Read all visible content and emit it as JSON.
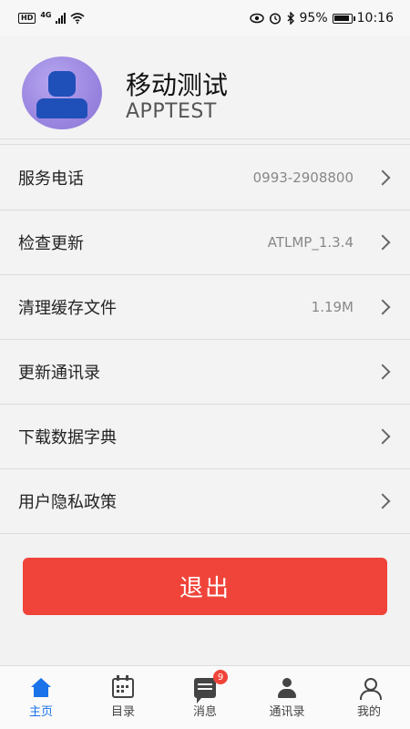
{
  "status_bar": {
    "hd": "HD",
    "network": "4G",
    "battery_percent": "95%",
    "time": "10:16",
    "icons": [
      "wifi-icon",
      "eye-icon",
      "alarm-icon",
      "bluetooth-icon",
      "battery-icon"
    ]
  },
  "profile": {
    "name": "移动测试",
    "subtitle": "APPTEST",
    "avatar_icon": "user-avatar-icon"
  },
  "menu": [
    {
      "label": "服务电话",
      "value": "0993-2908800"
    },
    {
      "label": "检查更新",
      "value": "ATLMP_1.3.4"
    },
    {
      "label": "清理缓存文件",
      "value": "1.19M"
    },
    {
      "label": "更新通讯录",
      "value": ""
    },
    {
      "label": "下载数据字典",
      "value": ""
    },
    {
      "label": "用户隐私政策",
      "value": ""
    }
  ],
  "logout_label": "退出",
  "tabs": [
    {
      "label": "主页",
      "icon": "home-icon",
      "active": true
    },
    {
      "label": "目录",
      "icon": "calendar-icon",
      "active": false
    },
    {
      "label": "消息",
      "icon": "message-icon",
      "active": false,
      "badge": "9"
    },
    {
      "label": "通讯录",
      "icon": "contacts-icon",
      "active": false
    },
    {
      "label": "我的",
      "icon": "profile-icon",
      "active": false
    }
  ],
  "colors": {
    "accent": "#1a73e8",
    "logout": "#f0443a",
    "avatar": "#9a86e0"
  }
}
